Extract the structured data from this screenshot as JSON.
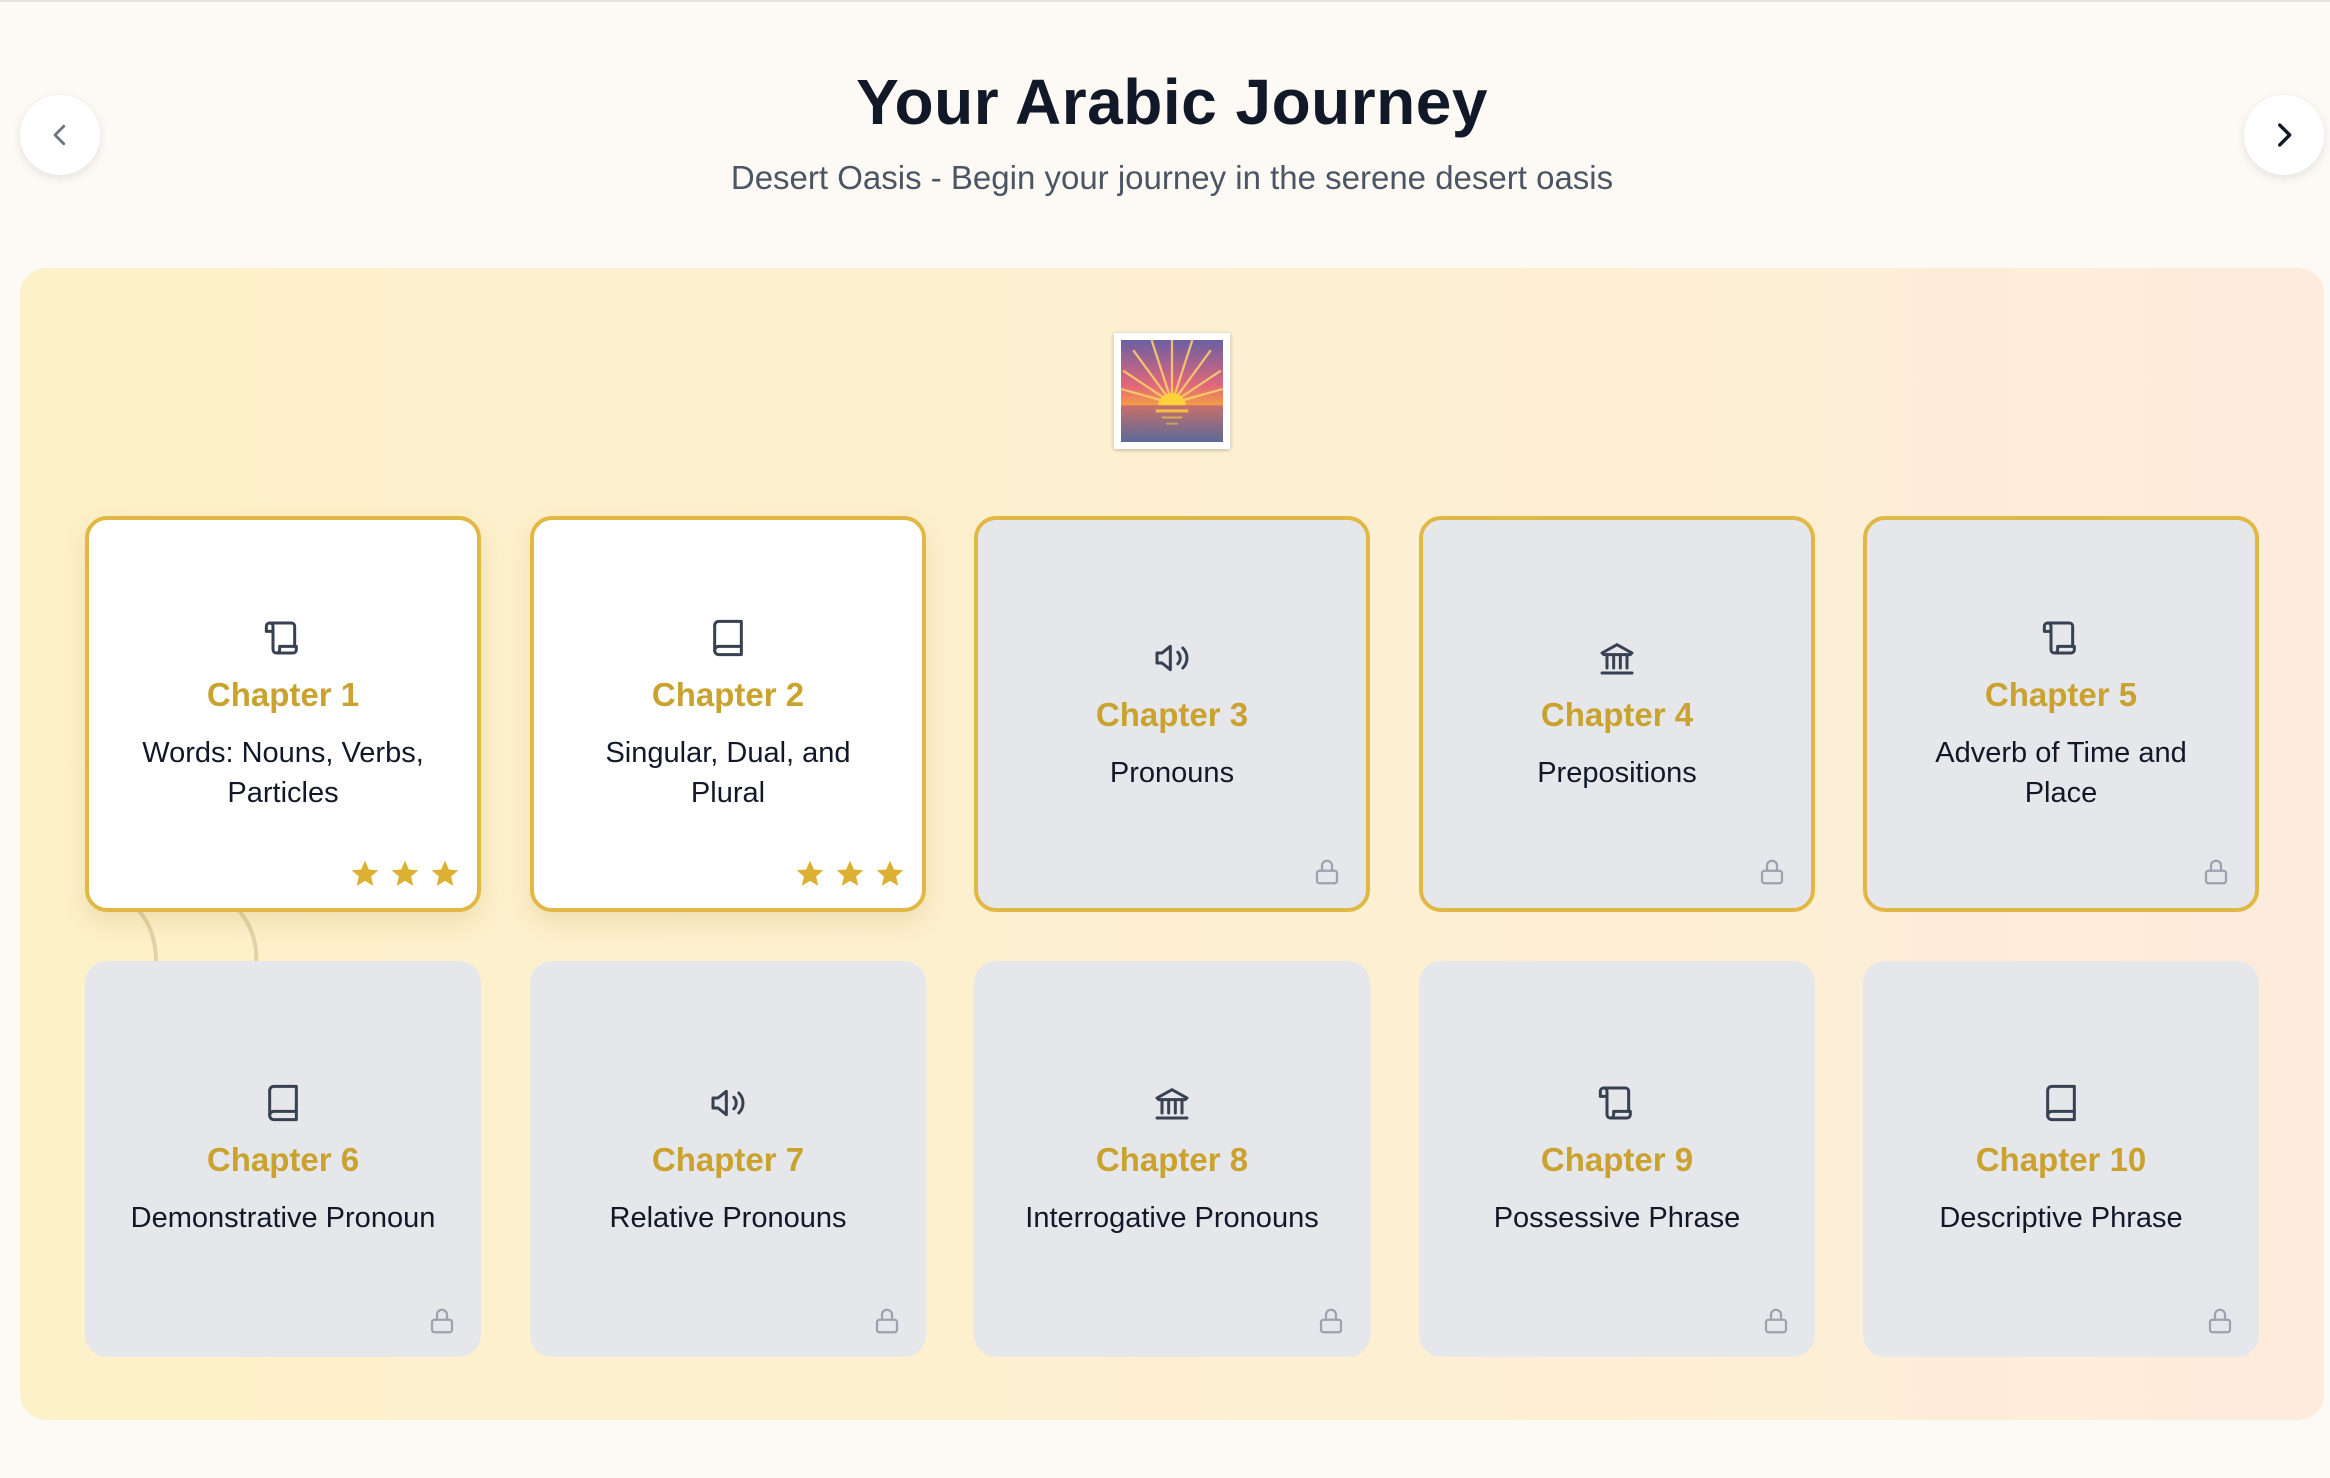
{
  "header": {
    "title": "Your Arabic Journey",
    "subtitle": "Desert Oasis - Begin your journey in the serene desert oasis"
  },
  "nav": {
    "prev_icon": "chevron-left-icon",
    "next_icon": "chevron-right-icon"
  },
  "scene": {
    "icon": "sunrise-emoji"
  },
  "colors": {
    "accent_gold": "#c9a22f",
    "border_gold": "#e2b844",
    "locked_bg": "#e6e7ea",
    "panel_bg": "#fdf1c9"
  },
  "chapters": [
    {
      "title": "Chapter 1",
      "subtitle": "Words: Nouns, Verbs, Particles",
      "icon": "scroll-icon",
      "status": "completed",
      "stars": 3
    },
    {
      "title": "Chapter 2",
      "subtitle": "Singular, Dual, and Plural",
      "icon": "book-icon",
      "status": "completed",
      "stars": 3
    },
    {
      "title": "Chapter 3",
      "subtitle": "Pronouns",
      "icon": "speaker-icon",
      "status": "locked",
      "stars": 0
    },
    {
      "title": "Chapter 4",
      "subtitle": "Prepositions",
      "icon": "landmark-icon",
      "status": "locked",
      "stars": 0
    },
    {
      "title": "Chapter 5",
      "subtitle": "Adverb of Time and Place",
      "icon": "scroll-icon",
      "status": "locked",
      "stars": 0
    },
    {
      "title": "Chapter 6",
      "subtitle": "Demonstrative Pronoun",
      "icon": "book-icon",
      "status": "locked",
      "stars": 0
    },
    {
      "title": "Chapter 7",
      "subtitle": "Relative Pronouns",
      "icon": "speaker-icon",
      "status": "locked",
      "stars": 0
    },
    {
      "title": "Chapter 8",
      "subtitle": "Interrogative Pronouns",
      "icon": "landmark-icon",
      "status": "locked",
      "stars": 0
    },
    {
      "title": "Chapter 9",
      "subtitle": "Possessive Phrase",
      "icon": "scroll-icon",
      "status": "locked",
      "stars": 0
    },
    {
      "title": "Chapter 10",
      "subtitle": "Descriptive Phrase",
      "icon": "book-icon",
      "status": "locked",
      "stars": 0
    }
  ]
}
